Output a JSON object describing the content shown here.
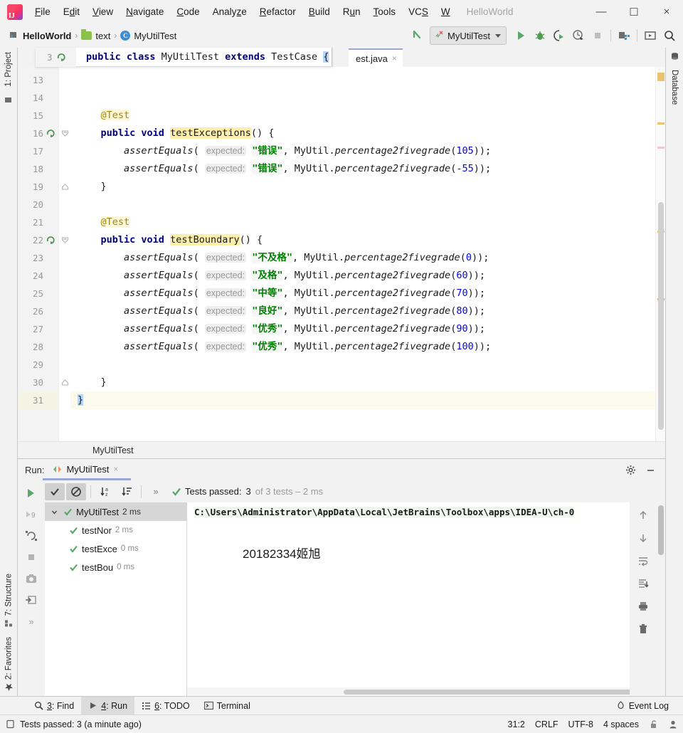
{
  "window": {
    "project_title": "HelloWorld",
    "minimize": "—",
    "maximize": "☐",
    "close": "×"
  },
  "menu": {
    "items": [
      {
        "label": "File",
        "mnemonic": "F"
      },
      {
        "label": "Edit",
        "mnemonic": "E"
      },
      {
        "label": "View",
        "mnemonic": "V"
      },
      {
        "label": "Navigate",
        "mnemonic": "N"
      },
      {
        "label": "Code",
        "mnemonic": "C"
      },
      {
        "label": "Analyze",
        "mnemonic": "z"
      },
      {
        "label": "Refactor",
        "mnemonic": "R"
      },
      {
        "label": "Build",
        "mnemonic": "B"
      },
      {
        "label": "Run",
        "mnemonic": "u"
      },
      {
        "label": "Tools",
        "mnemonic": "T"
      },
      {
        "label": "VCS",
        "mnemonic": "S"
      },
      {
        "label": "W",
        "mnemonic": "W"
      }
    ]
  },
  "navbar": {
    "breadcrumbs": [
      {
        "label": "HelloWorld",
        "icon": "project-icon"
      },
      {
        "label": "text",
        "icon": "folder-icon"
      },
      {
        "label": "MyUtilTest",
        "icon": "class-icon"
      }
    ],
    "separator": "›",
    "back_arrow": "back-arrow-icon",
    "run_config": "MyUtilTest",
    "buttons": [
      "run-button",
      "debug-button",
      "run-with-coverage-button",
      "profiler-button",
      "stop-button",
      "project-structure-button",
      "update-button",
      "search-everywhere-button"
    ]
  },
  "stripes": {
    "left": [
      {
        "label": "1: Project",
        "icon": "project-icon"
      },
      {
        "label": "7: Structure",
        "icon": "structure-icon"
      },
      {
        "label": "2: Favorites",
        "icon": "star-icon"
      }
    ],
    "right": [
      {
        "label": "Database",
        "icon": "database-icon"
      }
    ]
  },
  "editor": {
    "tab_label": "est.java",
    "tab_close": "×",
    "sticky": {
      "line_number": "3",
      "code_pre": "public class ",
      "code_name": "MyUtilTest",
      "code_extends": " extends ",
      "code_type": "TestCase ",
      "code_brace": "{"
    },
    "breadcrumb": "MyUtilTest",
    "first_line": 13,
    "lines": [
      {
        "num": 13,
        "tokens": []
      },
      {
        "num": 14,
        "tokens": []
      },
      {
        "num": 15,
        "tokens": [
          {
            "t": "    ",
            "c": "plain"
          },
          {
            "t": "@Test",
            "c": "ann-hl"
          }
        ]
      },
      {
        "num": 16,
        "gutter_icon": "run-test-icon",
        "fold": "open",
        "tokens": [
          {
            "t": "    ",
            "c": "plain"
          },
          {
            "t": "public void ",
            "c": "kw"
          },
          {
            "t": "testExceptions",
            "c": "usage"
          },
          {
            "t": "() {",
            "c": "plain"
          }
        ]
      },
      {
        "num": 17,
        "tokens": [
          {
            "t": "        ",
            "c": "plain"
          },
          {
            "t": "assertEquals",
            "c": "ital"
          },
          {
            "t": "( ",
            "c": "plain"
          },
          {
            "t": "expected:",
            "c": "hint"
          },
          {
            "t": " ",
            "c": "plain"
          },
          {
            "t": "\"错误\"",
            "c": "str"
          },
          {
            "t": ", MyUtil.",
            "c": "plain"
          },
          {
            "t": "percentage2fivegrade",
            "c": "ital"
          },
          {
            "t": "(",
            "c": "plain"
          },
          {
            "t": "105",
            "c": "num"
          },
          {
            "t": "));",
            "c": "plain"
          }
        ]
      },
      {
        "num": 18,
        "tokens": [
          {
            "t": "        ",
            "c": "plain"
          },
          {
            "t": "assertEquals",
            "c": "ital"
          },
          {
            "t": "( ",
            "c": "plain"
          },
          {
            "t": "expected:",
            "c": "hint"
          },
          {
            "t": " ",
            "c": "plain"
          },
          {
            "t": "\"错误\"",
            "c": "str"
          },
          {
            "t": ", MyUtil.",
            "c": "plain"
          },
          {
            "t": "percentage2fivegrade",
            "c": "ital"
          },
          {
            "t": "(",
            "c": "plain"
          },
          {
            "t": "-55",
            "c": "num"
          },
          {
            "t": "));",
            "c": "plain"
          }
        ]
      },
      {
        "num": 19,
        "fold": "close",
        "tokens": [
          {
            "t": "    }",
            "c": "plain"
          }
        ]
      },
      {
        "num": 20,
        "tokens": []
      },
      {
        "num": 21,
        "tokens": [
          {
            "t": "    ",
            "c": "plain"
          },
          {
            "t": "@Test",
            "c": "ann-hl"
          }
        ]
      },
      {
        "num": 22,
        "gutter_icon": "run-test-icon",
        "fold": "open",
        "tokens": [
          {
            "t": "    ",
            "c": "plain"
          },
          {
            "t": "public void ",
            "c": "kw"
          },
          {
            "t": "testBoundary",
            "c": "usage"
          },
          {
            "t": "() {",
            "c": "plain"
          }
        ]
      },
      {
        "num": 23,
        "tokens": [
          {
            "t": "        ",
            "c": "plain"
          },
          {
            "t": "assertEquals",
            "c": "ital"
          },
          {
            "t": "( ",
            "c": "plain"
          },
          {
            "t": "expected:",
            "c": "hint"
          },
          {
            "t": " ",
            "c": "plain"
          },
          {
            "t": "\"不及格\"",
            "c": "str"
          },
          {
            "t": ", MyUtil.",
            "c": "plain"
          },
          {
            "t": "percentage2fivegrade",
            "c": "ital"
          },
          {
            "t": "(",
            "c": "plain"
          },
          {
            "t": "0",
            "c": "num"
          },
          {
            "t": "));",
            "c": "plain"
          }
        ]
      },
      {
        "num": 24,
        "tokens": [
          {
            "t": "        ",
            "c": "plain"
          },
          {
            "t": "assertEquals",
            "c": "ital"
          },
          {
            "t": "( ",
            "c": "plain"
          },
          {
            "t": "expected:",
            "c": "hint"
          },
          {
            "t": " ",
            "c": "plain"
          },
          {
            "t": "\"及格\"",
            "c": "str"
          },
          {
            "t": ", MyUtil.",
            "c": "plain"
          },
          {
            "t": "percentage2fivegrade",
            "c": "ital"
          },
          {
            "t": "(",
            "c": "plain"
          },
          {
            "t": "60",
            "c": "num"
          },
          {
            "t": "));",
            "c": "plain"
          }
        ]
      },
      {
        "num": 25,
        "tokens": [
          {
            "t": "        ",
            "c": "plain"
          },
          {
            "t": "assertEquals",
            "c": "ital"
          },
          {
            "t": "( ",
            "c": "plain"
          },
          {
            "t": "expected:",
            "c": "hint"
          },
          {
            "t": " ",
            "c": "plain"
          },
          {
            "t": "\"中等\"",
            "c": "str"
          },
          {
            "t": ", MyUtil.",
            "c": "plain"
          },
          {
            "t": "percentage2fivegrade",
            "c": "ital"
          },
          {
            "t": "(",
            "c": "plain"
          },
          {
            "t": "70",
            "c": "num"
          },
          {
            "t": "));",
            "c": "plain"
          }
        ]
      },
      {
        "num": 26,
        "tokens": [
          {
            "t": "        ",
            "c": "plain"
          },
          {
            "t": "assertEquals",
            "c": "ital"
          },
          {
            "t": "( ",
            "c": "plain"
          },
          {
            "t": "expected:",
            "c": "hint"
          },
          {
            "t": " ",
            "c": "plain"
          },
          {
            "t": "\"良好\"",
            "c": "str"
          },
          {
            "t": ", MyUtil.",
            "c": "plain"
          },
          {
            "t": "percentage2fivegrade",
            "c": "ital"
          },
          {
            "t": "(",
            "c": "plain"
          },
          {
            "t": "80",
            "c": "num"
          },
          {
            "t": "));",
            "c": "plain"
          }
        ]
      },
      {
        "num": 27,
        "tokens": [
          {
            "t": "        ",
            "c": "plain"
          },
          {
            "t": "assertEquals",
            "c": "ital"
          },
          {
            "t": "( ",
            "c": "plain"
          },
          {
            "t": "expected:",
            "c": "hint"
          },
          {
            "t": " ",
            "c": "plain"
          },
          {
            "t": "\"优秀\"",
            "c": "str"
          },
          {
            "t": ", MyUtil.",
            "c": "plain"
          },
          {
            "t": "percentage2fivegrade",
            "c": "ital"
          },
          {
            "t": "(",
            "c": "plain"
          },
          {
            "t": "90",
            "c": "num"
          },
          {
            "t": "));",
            "c": "plain"
          }
        ]
      },
      {
        "num": 28,
        "tokens": [
          {
            "t": "        ",
            "c": "plain"
          },
          {
            "t": "assertEquals",
            "c": "ital"
          },
          {
            "t": "( ",
            "c": "plain"
          },
          {
            "t": "expected:",
            "c": "hint"
          },
          {
            "t": " ",
            "c": "plain"
          },
          {
            "t": "\"优秀\"",
            "c": "str"
          },
          {
            "t": ", MyUtil.",
            "c": "plain"
          },
          {
            "t": "percentage2fivegrade",
            "c": "ital"
          },
          {
            "t": "(",
            "c": "plain"
          },
          {
            "t": "100",
            "c": "num"
          },
          {
            "t": "));",
            "c": "plain"
          }
        ]
      },
      {
        "num": 29,
        "tokens": []
      },
      {
        "num": 30,
        "fold": "close",
        "tokens": [
          {
            "t": "    }",
            "c": "plain"
          }
        ]
      },
      {
        "num": 31,
        "current": true,
        "tokens": [
          {
            "t": "}",
            "c": "selbrace"
          }
        ]
      }
    ]
  },
  "run_panel": {
    "label": "Run:",
    "tab_title": "MyUtilTest",
    "tab_close": "×",
    "settings_icon": "gear-icon",
    "minimize_icon": "minimize-icon",
    "toolbar": {
      "rerun": "rerun-icon",
      "show_passed": "show-passed-icon",
      "hide_ignored": "hide-ignored-icon",
      "sort_alpha": "sort-alphabetically-icon",
      "sort_duration": "sort-by-duration-icon",
      "expand": "»"
    },
    "status": {
      "prefix": "Tests passed:",
      "count": "3",
      "suffix": "of 3 tests – 2 ms"
    },
    "tree": [
      {
        "name": "MyUtilTest",
        "duration": "2 ms",
        "level": 0,
        "selected": true,
        "expanded": true,
        "state": "passed"
      },
      {
        "name": "testNor",
        "duration": "2 ms",
        "level": 1,
        "selected": false,
        "state": "passed"
      },
      {
        "name": "testExce",
        "duration": "0 ms",
        "level": 1,
        "selected": false,
        "state": "passed"
      },
      {
        "name": "testBou",
        "duration": "0 ms",
        "level": 1,
        "selected": false,
        "state": "passed"
      }
    ],
    "console": {
      "command_line": "C:\\Users\\Administrator\\AppData\\Local\\JetBrains\\Toolbox\\apps\\IDEA-U\\ch-0",
      "output": "20182334姬旭"
    },
    "left_toolbar": [
      "rerun-failed-icon",
      "rerun-automatically-icon",
      "stop-icon",
      "screenshot-icon",
      "export-icon",
      "more-icon"
    ],
    "right_toolbar": [
      "up-arrow-icon",
      "down-arrow-icon",
      "soft-wrap-icon",
      "scroll-to-end-icon",
      "print-icon",
      "trash-icon"
    ]
  },
  "bottom_tabs": [
    {
      "label": "3: Find",
      "mnemonic": "3",
      "icon": "search-icon",
      "active": false
    },
    {
      "label": "4: Run",
      "mnemonic": "4",
      "icon": "run-icon",
      "active": true
    },
    {
      "label": "6: TODO",
      "mnemonic": "6",
      "icon": "todo-icon",
      "active": false
    },
    {
      "label": "Terminal",
      "mnemonic": "",
      "icon": "terminal-icon",
      "active": false
    }
  ],
  "event_log": {
    "label": "Event Log",
    "icon": "event-log-icon"
  },
  "statusbar": {
    "message": "Tests passed: 3 (a minute ago)",
    "caret": "31:2",
    "line_sep": "CRLF",
    "encoding": "UTF-8",
    "indent": "4 spaces",
    "lock_icon": "unlocked-icon",
    "inspector_icon": "inspection-icon"
  },
  "colors": {
    "accent_green": "#59a869",
    "string_green": "#008000",
    "keyword_navy": "#000080",
    "number_blue": "#0000ff",
    "warning_yellow": "#e9c46a",
    "tab_underline": "#9aa7d0"
  }
}
